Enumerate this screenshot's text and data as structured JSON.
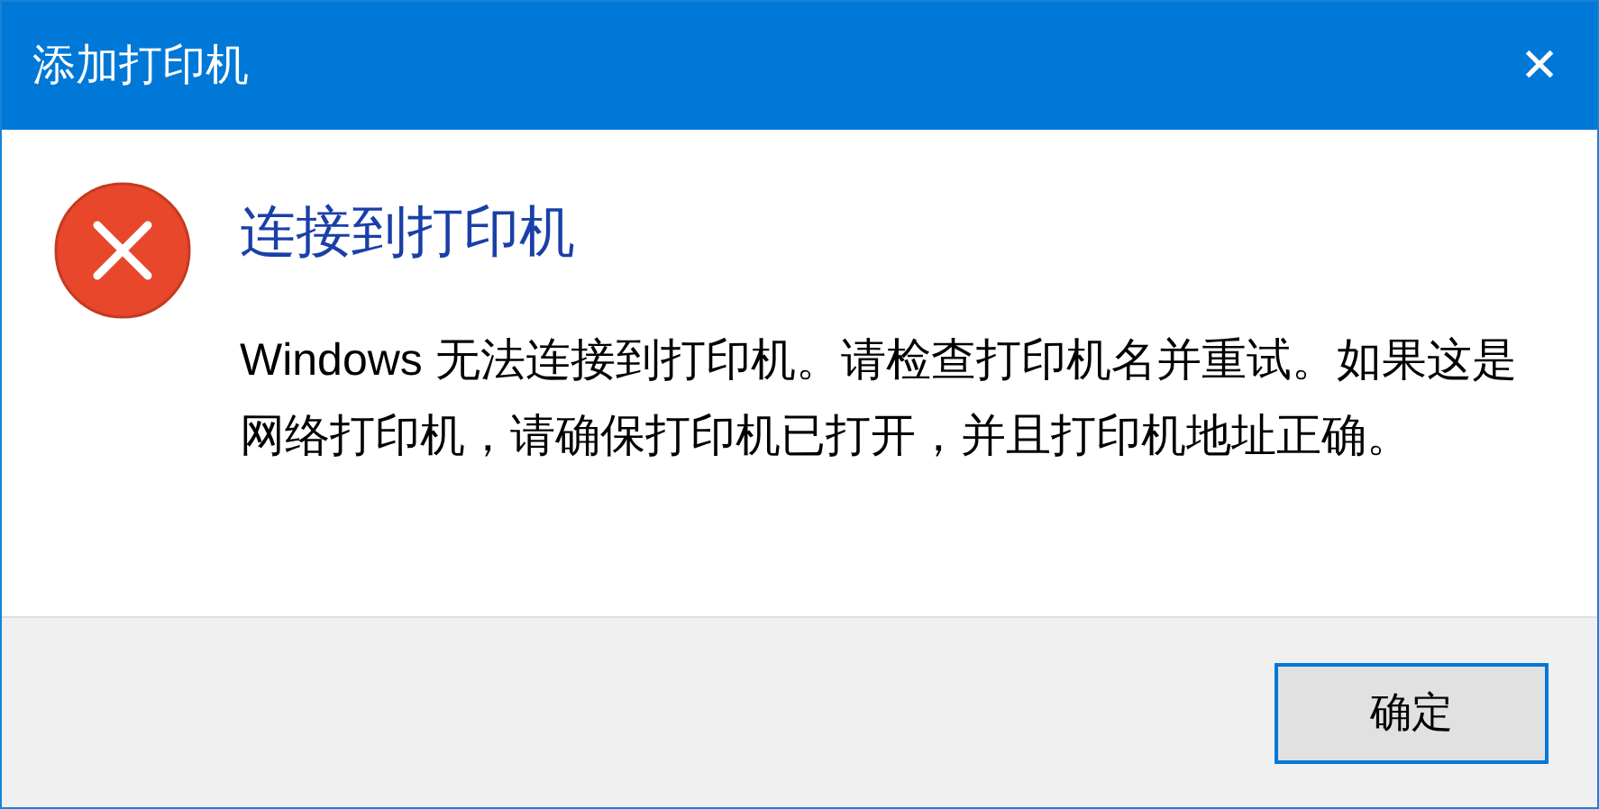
{
  "window": {
    "title": "添加打印机",
    "close": "✕"
  },
  "icon": {
    "kind": "error"
  },
  "heading": "连接到打印机",
  "message": "Windows 无法连接到打印机。请检查打印机名并重试。如果这是网络打印机，请确保打印机已打开，并且打印机地址正确。",
  "buttons": [
    {
      "label": "确定",
      "default": true
    }
  ]
}
